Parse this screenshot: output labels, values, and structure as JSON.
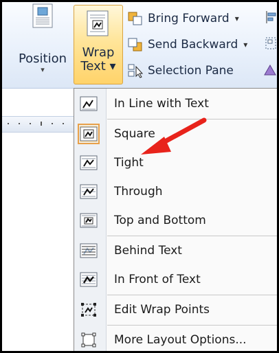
{
  "ribbon": {
    "position": {
      "label": "Position",
      "arrow": "▾",
      "icon": "position-icon"
    },
    "wrap_text": {
      "label_line1": "Wrap",
      "label_line2": "Text ▾",
      "icon": "wrap-text-icon"
    },
    "bring_forward": {
      "label": "Bring Forward",
      "dropdown": "▾",
      "icon": "bring-forward-icon"
    },
    "send_backward": {
      "label": "Send Backward",
      "dropdown": "▾",
      "icon": "send-backward-icon"
    },
    "selection_pane": {
      "label": "Selection Pane",
      "icon": "selection-pane-icon"
    }
  },
  "menu": {
    "items": [
      {
        "label": "In Line with Text",
        "icon": "inline-with-text-icon"
      },
      {
        "label": "Square",
        "icon": "square-wrap-icon",
        "selected": true
      },
      {
        "label": "Tight",
        "icon": "tight-wrap-icon"
      },
      {
        "label": "Through",
        "icon": "through-wrap-icon"
      },
      {
        "label": "Top and Bottom",
        "icon": "top-and-bottom-wrap-icon"
      },
      {
        "label": "Behind Text",
        "icon": "behind-text-icon"
      },
      {
        "label": "In Front of Text",
        "icon": "in-front-of-text-icon"
      },
      {
        "label": "Edit Wrap Points",
        "icon": "edit-wrap-points-icon"
      },
      {
        "label": "More Layout Options...",
        "icon": "more-layout-options-icon"
      }
    ]
  },
  "annotation": {
    "arrow_color": "#e8231b",
    "icon": "red-arrow-annotation"
  },
  "colors": {
    "accent": "#ffd36a",
    "menu_bg": "#fafafa",
    "ribbon_bg": "#e8f0fb"
  }
}
